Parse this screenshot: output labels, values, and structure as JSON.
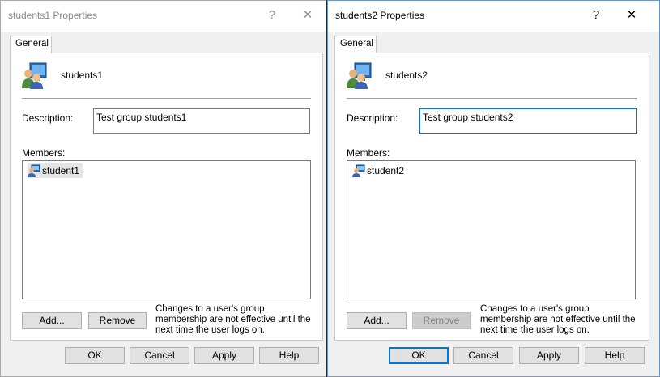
{
  "dialogs": [
    {
      "title": "students1 Properties",
      "help_glyph": "?",
      "close_glyph": "✕",
      "tab": "General",
      "group_name": "students1",
      "description_label": "Description:",
      "description_value": "Test group students1",
      "members_label": "Members:",
      "members": [
        "student1"
      ],
      "add_label": "Add...",
      "remove_label": "Remove",
      "note": "Changes to a user's group membership are not effective until the next time the user logs on.",
      "ok_label": "OK",
      "cancel_label": "Cancel",
      "apply_label": "Apply",
      "help_label": "Help"
    },
    {
      "title": "students2 Properties",
      "help_glyph": "?",
      "close_glyph": "✕",
      "tab": "General",
      "group_name": "students2",
      "description_label": "Description:",
      "description_value": "Test group students2",
      "members_label": "Members:",
      "members": [
        "student2"
      ],
      "add_label": "Add...",
      "remove_label": "Remove",
      "note": "Changes to a user's group membership are not effective until the next time the user logs on.",
      "ok_label": "OK",
      "cancel_label": "Cancel",
      "apply_label": "Apply",
      "help_label": "Help"
    }
  ],
  "colors": {
    "accent": "#0078d7",
    "desktop": "#0b2a57",
    "dialog_bg": "#f0f0f0"
  }
}
